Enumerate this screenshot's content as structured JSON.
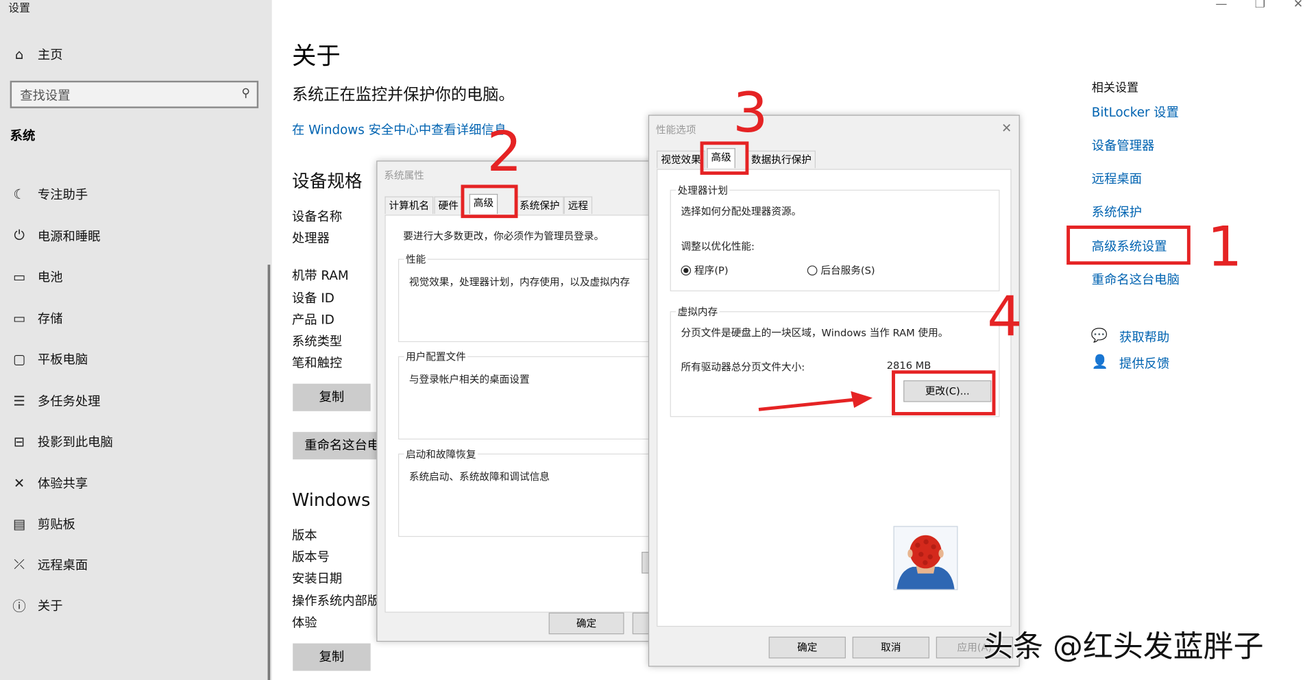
{
  "window": {
    "title": "设置"
  },
  "sidebar": {
    "home": "主页",
    "search_placeholder": "查找设置",
    "section": "系统",
    "items": [
      {
        "label": "专注助手",
        "icon": "moon-icon"
      },
      {
        "label": "电源和睡眠",
        "icon": "power-icon"
      },
      {
        "label": "电池",
        "icon": "battery-icon"
      },
      {
        "label": "存储",
        "icon": "storage-icon"
      },
      {
        "label": "平板电脑",
        "icon": "tablet-icon"
      },
      {
        "label": "多任务处理",
        "icon": "multitask-icon"
      },
      {
        "label": "投影到此电脑",
        "icon": "project-icon"
      },
      {
        "label": "体验共享",
        "icon": "share-icon"
      },
      {
        "label": "剪贴板",
        "icon": "clipboard-icon"
      },
      {
        "label": "远程桌面",
        "icon": "remote-icon"
      },
      {
        "label": "关于",
        "icon": "info-icon"
      }
    ]
  },
  "main": {
    "title": "关于",
    "subtitle": "系统正在监控并保护你的电脑。",
    "security_link": "在 Windows 安全中心中查看详细信息",
    "spec_heading": "设备规格",
    "spec_labels": [
      "设备名称",
      "处理器",
      "机带 RAM",
      "设备 ID",
      "产品 ID",
      "系统类型",
      "笔和触控"
    ],
    "copy_button": "复制",
    "rename_button": "重命名这台电",
    "windows_heading": "Windows 规",
    "win_labels": [
      "版本",
      "版本号",
      "安装日期",
      "操作系统内部版",
      "体验"
    ],
    "copy_button2": "复制"
  },
  "related": {
    "heading": "相关设置",
    "links": [
      "BitLocker 设置",
      "设备管理器",
      "远程桌面",
      "系统保护",
      "高级系统设置",
      "重命名这台电脑"
    ],
    "help": "获取帮助",
    "feedback": "提供反馈"
  },
  "sysprops": {
    "title": "系统属性",
    "tabs": [
      "计算机名",
      "硬件",
      "高级",
      "系统保护",
      "远程"
    ],
    "admin_note": "要进行大多数更改，你必须作为管理员登录。",
    "perf_label": "性能",
    "perf_desc": "视觉效果，处理器计划，内存使用，以及虚拟内存",
    "profile_label": "用户配置文件",
    "profile_desc": "与登录帐户相关的桌面设置",
    "startup_label": "启动和故障恢复",
    "startup_desc": "系统启动、系统故障和调试信息",
    "ok": "确定"
  },
  "perfopts": {
    "title": "性能选项",
    "tabs": [
      "视觉效果",
      "高级",
      "数据执行保护"
    ],
    "proc_label": "处理器计划",
    "proc_desc": "选择如何分配处理器资源。",
    "adjust_label": "调整以优化性能:",
    "radio_programs": "程序(P)",
    "radio_background": "后台服务(S)",
    "vm_label": "虚拟内存",
    "vm_desc": "分页文件是硬盘上的一块区域，Windows 当作 RAM 使用。",
    "total_label": "所有驱动器总分页文件大小:",
    "total_value": "2816 MB",
    "change_button": "更改(C)...",
    "ok": "确定",
    "cancel": "取消",
    "apply": "应用(A)"
  },
  "annotations": [
    "1",
    "2",
    "3",
    "4"
  ],
  "watermark": "头条 @红头发蓝胖子",
  "colors": {
    "accent": "#0063b1",
    "annotation": "#e52324",
    "sidebar_bg": "#e6e6e6"
  }
}
